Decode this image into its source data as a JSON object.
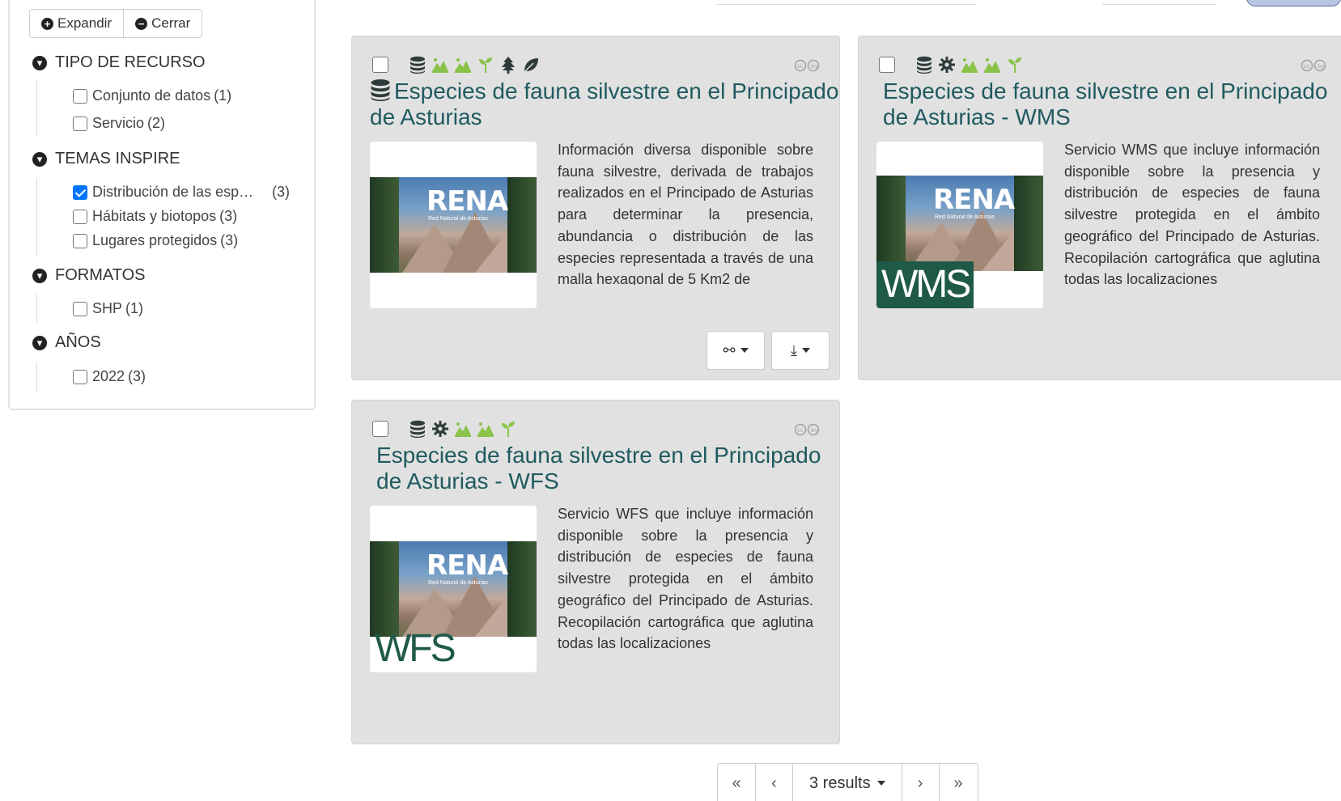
{
  "facets": {
    "expand_label": "Expandir",
    "close_label": "Cerrar",
    "groups": [
      {
        "title": "TIPO DE RECURSO",
        "items": [
          {
            "label": "Conjunto de datos",
            "count": "(1)",
            "checked": false
          },
          {
            "label": "Servicio",
            "count": "(2)",
            "checked": false
          }
        ]
      },
      {
        "title": "TEMAS INSPIRE",
        "items": [
          {
            "label": "Distribución de las esp…",
            "count": "(3)",
            "checked": true
          },
          {
            "label": "Hábitats y biotopos",
            "count": "(3)",
            "checked": false
          },
          {
            "label": "Lugares protegidos",
            "count": "(3)",
            "checked": false
          }
        ]
      },
      {
        "title": "FORMATOS",
        "items": [
          {
            "label": "SHP",
            "count": "(1)",
            "checked": false
          }
        ]
      },
      {
        "title": "AÑOS",
        "items": [
          {
            "label": "2022",
            "count": "(3)",
            "checked": false
          }
        ]
      }
    ]
  },
  "results": [
    {
      "title": "Especies de fauna silvestre en el Principado de Asturias",
      "icons": [
        "database-icon",
        "landscape-icon",
        "landscape-icon",
        "sprout-icon",
        "tree-icon",
        "leaf-icon"
      ],
      "thumb_logo": "RENA",
      "thumb_sub": "Red Natural de Asturias",
      "badge": "",
      "description": "Información diversa disponible sobre fauna silvestre, derivada de trabajos realizados en el Principado de Asturias para determinar la presencia, abundancia o distribución de las especies representada a través de una malla hexagonal de 5 Km2 de"
    },
    {
      "title": "Especies de fauna silvestre en el Principado de Asturias - WMS",
      "icons": [
        "database-icon",
        "gear-icon",
        "landscape-icon",
        "landscape-icon",
        "sprout-icon"
      ],
      "thumb_logo": "RENA",
      "thumb_sub": "Red Natural de Asturias",
      "badge": "WMS",
      "description": "Servicio WMS que incluye información disponible sobre la presencia y distribución de especies de fauna silvestre protegida en el ámbito geográfico del Principado de Asturias. Recopilación cartográfica que aglutina todas las localizaciones"
    },
    {
      "title": "Especies de fauna silvestre en el Principado de Asturias - WFS",
      "icons": [
        "database-icon",
        "gear-icon",
        "landscape-icon",
        "landscape-icon",
        "sprout-icon"
      ],
      "thumb_logo": "RENA",
      "thumb_sub": "Red Natural de Asturias",
      "badge": "WFS",
      "description": "Servicio WFS que incluye información disponible sobre la presencia y distribución de especies de fauna silvestre protegida en el ámbito geográfico del Principado de Asturias. Recopilación cartográfica que aglutina todas las localizaciones"
    }
  ],
  "pagination": {
    "first": "«",
    "prev": "‹",
    "results_label": "3 results",
    "next": "›",
    "last": "»"
  },
  "colors": {
    "title": "#1f5a5f",
    "icon_green": "#8bc34a",
    "card_bg": "#e1e1e1",
    "checkbox_checked": "#0075ff"
  }
}
